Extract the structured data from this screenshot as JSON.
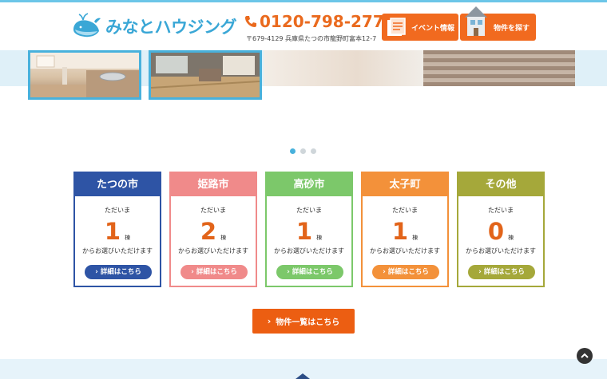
{
  "header": {
    "logo_text": "みなとハウジング",
    "phone": "0120-798-277",
    "address": "〒679-4129 兵庫県たつの市龍野町富本12-7",
    "event_button": "イベント情報",
    "search_button": "物件を探す"
  },
  "slider": {
    "dot_count": 3,
    "active_dot": 1
  },
  "cards": [
    {
      "title": "たつの市",
      "tadaima": "ただいま",
      "count": "1",
      "unit": "棟",
      "from": "からお選びいただけます",
      "detail": "詳細はこちら",
      "color": "#2e54a5",
      "count_color": "#e2641a"
    },
    {
      "title": "姫路市",
      "tadaima": "ただいま",
      "count": "2",
      "unit": "棟",
      "from": "からお選びいただけます",
      "detail": "詳細はこちら",
      "color": "#f08a8a",
      "count_color": "#e2641a"
    },
    {
      "title": "高砂市",
      "tadaima": "ただいま",
      "count": "1",
      "unit": "棟",
      "from": "からお選びいただけます",
      "detail": "詳細はこちら",
      "color": "#7cc86a",
      "count_color": "#e2641a"
    },
    {
      "title": "太子町",
      "tadaima": "ただいま",
      "count": "1",
      "unit": "棟",
      "from": "からお選びいただけます",
      "detail": "詳細はこちら",
      "color": "#f3913a",
      "count_color": "#e2641a"
    },
    {
      "title": "その他",
      "tadaima": "ただいま",
      "count": "0",
      "unit": "棟",
      "from": "からお選びいただけます",
      "detail": "詳細はこちら",
      "color": "#a5a83a",
      "count_color": "#e2641a"
    }
  ],
  "list_button": "物件一覧はこちら",
  "icons": {
    "logo": "whale-icon",
    "phone": "phone-icon",
    "event": "calendar-icon",
    "search": "house-icon",
    "back_to_top": "chevron-up-icon"
  },
  "colors": {
    "brand_blue": "#3aa7d6",
    "accent_orange": "#f16a1f",
    "phone_orange": "#ea6a1e"
  }
}
